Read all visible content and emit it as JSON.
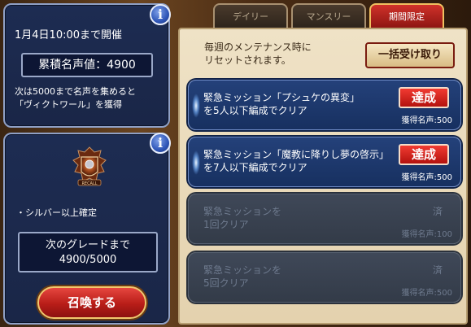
{
  "left_top": {
    "deadline": "1月4日10:00まで開催",
    "fame_label": "累積名声値：",
    "fame_value": "4900",
    "reward_line1": "次は5000まで名声を集めると",
    "reward_line2": "「ヴィクトワール」を獲得"
  },
  "left_bottom": {
    "crest_text": "RECALL",
    "silver_text": "・シルバー以上確定",
    "grade_line1": "次のグレードまで",
    "grade_line2": "4900/5000",
    "summon_label": "召喚する"
  },
  "tabs": [
    {
      "label": "デイリー"
    },
    {
      "label": "マンスリー"
    },
    {
      "label": "期間限定"
    }
  ],
  "right": {
    "notice_line1": "毎週のメンテナンス時に",
    "notice_line2": "リセットされます。",
    "collect_label": "一括受け取り",
    "missions": [
      {
        "line1": "緊急ミッション「プシュケの異変」",
        "line2": "を5人以下編成でクリア",
        "status": "達成",
        "reward": "獲得名声:500"
      },
      {
        "line1": "緊急ミッション「魔教に降りし夢の啓示」",
        "line2": "を7人以下編成でクリア",
        "status": "達成",
        "reward": "獲得名声:500"
      },
      {
        "line1": "緊急ミッションを",
        "line2": "1回クリア",
        "status": "済",
        "reward": "獲得名声:100"
      },
      {
        "line1": "緊急ミッションを",
        "line2": "5回クリア",
        "status": "済",
        "reward": "獲得名声:500"
      }
    ]
  },
  "info_icon": "i",
  "colors": {
    "accent_red": "#d0322a",
    "panel_blue": "#1d2c52",
    "gold_border": "#f0c060"
  }
}
